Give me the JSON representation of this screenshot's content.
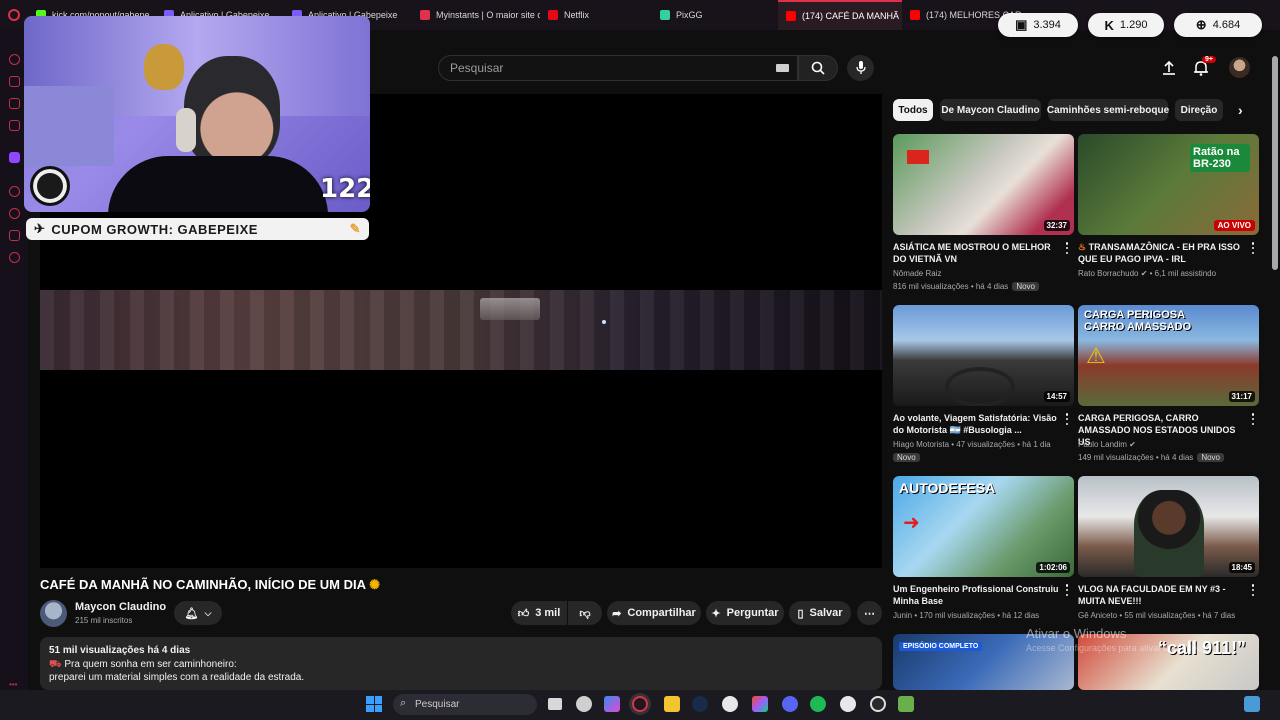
{
  "browser": {
    "tabs": [
      {
        "title": "kick.com/popout/gabepe…",
        "color": "#53fc18"
      },
      {
        "title": "Aplicativo | Gabepeixe",
        "color": "#7b5cff"
      },
      {
        "title": "Aplicativo | Gabepeixe",
        "color": "#7b5cff"
      },
      {
        "title": "Myinstants | O maior site d…",
        "color": "#e0304a"
      },
      {
        "title": "Netflix",
        "color": "#e50914"
      },
      {
        "title": "PixGG",
        "color": "#35d0a0"
      },
      {
        "title": "(174) CAFÉ DA MANHÃ NO…",
        "color": "#ff0000"
      },
      {
        "title": "(174) MELHORES CARRO…",
        "color": "#ff0000"
      }
    ]
  },
  "counters": [
    {
      "icon": "twitch-icon",
      "value": "3.394"
    },
    {
      "icon": "kick-icon",
      "value": "1.290"
    },
    {
      "icon": "globe-icon",
      "value": "4.684"
    }
  ],
  "header": {
    "search_placeholder": "Pesquisar",
    "notification_count": "9+"
  },
  "stream_overlay": {
    "cam_count": "122",
    "coupon_text": "CUPOM GROWTH: GABEPEIXE"
  },
  "video": {
    "title": "CAFÉ DA MANHÃ NO CAMINHÃO, INÍCIO DE UM DIA",
    "channel": "Maycon Claudino",
    "subscribers": "215 mil inscritos",
    "likes": "3 mil",
    "share_label": "Compartilhar",
    "ask_label": "Perguntar",
    "save_label": "Salvar",
    "description_stats": "51 mil visualizações  há 4 dias",
    "description_line1": "Pra quem sonha em ser caminhoneiro:",
    "description_line2": "preparei um material simples com a realidade da estrada."
  },
  "chips": [
    "Todos",
    "De Maycon Claudino",
    "Caminhões semi-reboque",
    "Direção"
  ],
  "related": [
    {
      "title": "ASIÁTICA ME MOSTROU O MELHOR DO VIETNÃ VN",
      "channel": "Nômade Raiz",
      "meta": "816 mil visualizações • há 4 dias",
      "badge": "Novo",
      "duration": "32:37",
      "thumb_text": ""
    },
    {
      "title": "TRANSAMAZÔNICA - EH PRA ISSO QUE EU PAGO IPVA - IRL",
      "channel": "Rato Borrachudo",
      "meta": "• 6,1 mil assistindo",
      "badge": "",
      "duration": "AO VIVO",
      "thumb_text": "Ratão na BR-230"
    },
    {
      "title": "Ao volante, Viagem Satisfatória: Visão do Motorista 🇦🇷 #Busologia ...",
      "channel": "Hiago Motorista",
      "meta": "• 47 visualizações • há 1 dia",
      "badge": "Novo",
      "duration": "14:57",
      "thumb_text": ""
    },
    {
      "title": "CARGA PERIGOSA, CARRO AMASSADO NOS ESTADOS UNIDOS US",
      "channel": "Paulo Landim",
      "meta": "149 mil visualizações • há 4 dias",
      "badge": "Novo",
      "duration": "31:17",
      "thumb_text": "CARGA PERIGOSA CARRO AMASSADO"
    },
    {
      "title": "Um Engenheiro Profissional Construiu Minha Base",
      "channel": "Junin",
      "meta": "• 170 mil visualizações • há 12 dias",
      "badge": "",
      "duration": "1:02:06",
      "thumb_text": "AUTODEFESA"
    },
    {
      "title": "VLOG NA FACULDADE EM NY #3 - MUITA NEVE!!!",
      "channel": "Gê Aniceto",
      "meta": "• 55 mil visualizações • há 7 dias",
      "badge": "",
      "duration": "18:45",
      "thumb_text": ""
    },
    {
      "title": "",
      "channel": "",
      "meta": "",
      "badge": "",
      "duration": "",
      "thumb_text": "EPISÓDIO COMPLETO"
    },
    {
      "title": "",
      "channel": "",
      "meta": "",
      "badge": "",
      "duration": "",
      "thumb_text": "“call 911!”"
    }
  ],
  "watermark": {
    "title": "Ativar o Windows",
    "subtitle": "Acesse Configurações para ativar o Windows."
  },
  "taskbar": {
    "search_placeholder": "Pesquisar"
  }
}
